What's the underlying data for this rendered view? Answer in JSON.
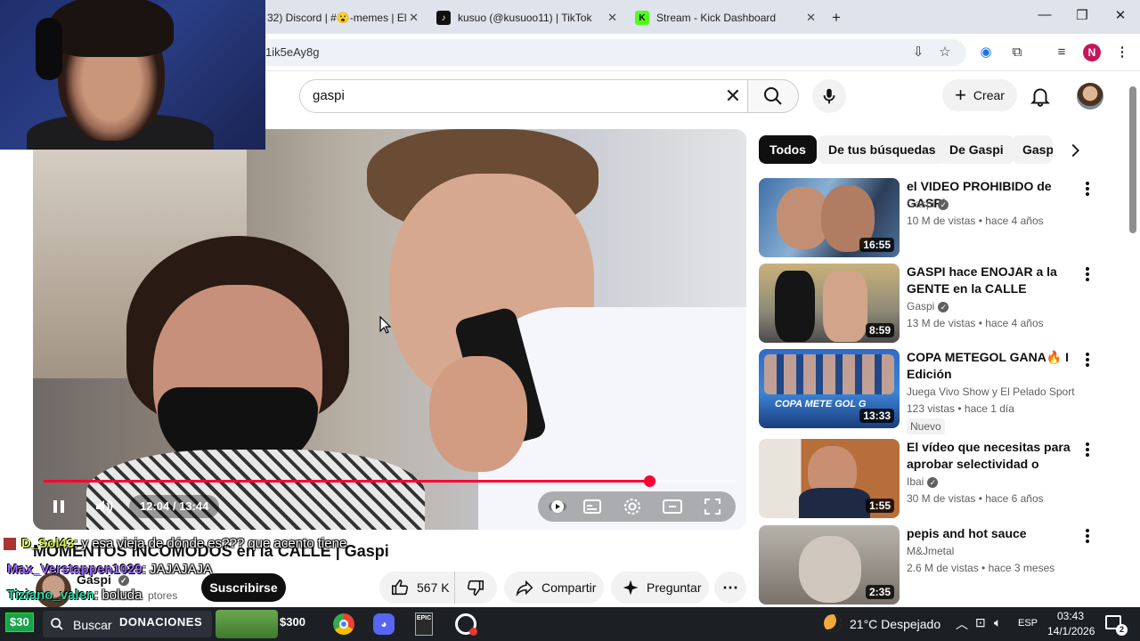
{
  "browser": {
    "tabs": [
      {
        "label": "32) Discord | #😮-memes | El"
      },
      {
        "label": "kusuo (@kusuoo11) | TikTok"
      },
      {
        "label": "Stream - Kick Dashboard"
      }
    ],
    "new_tab": "+",
    "url": "1ik5eAy8g",
    "profile_initial": "N"
  },
  "youtube": {
    "search_value": "gaspi",
    "create_label": "Crear"
  },
  "video": {
    "time": "12:04 / 13:44",
    "progress": 0.874,
    "title": "MOMENTOS INCOMODOS en la CALLE | Gaspi",
    "channel": "Gaspi",
    "subs_partial": "ptores",
    "subscribe_label": "Suscribirse",
    "likes": "567 K",
    "share_label": "Compartir",
    "ask_label": "Preguntar"
  },
  "chat": [
    {
      "user": "D_Sol43",
      "message": ": y esa vieja de dónde es??? que acento tiene"
    },
    {
      "user": "Max_Verstappen1029",
      "message": ": JAJAJAJA"
    },
    {
      "user": "Tiziano_valen",
      "message": ": boluda"
    }
  ],
  "chips": [
    {
      "label": "Todos",
      "active": true
    },
    {
      "label": "De tus búsquedas"
    },
    {
      "label": "De Gaspi"
    },
    {
      "label": "Gaspi"
    }
  ],
  "recommendations": [
    {
      "title": "el VIDEO PROHIBIDO de GASPI",
      "channel": "Gaspi",
      "verified": true,
      "meta": "10 M de vistas • hace 4 años",
      "duration": "16:55"
    },
    {
      "title": "GASPI hace ENOJAR a la GENTE en la CALLE",
      "channel": "Gaspi",
      "verified": true,
      "meta": "13 M de vistas • hace 4 años",
      "duration": "8:59"
    },
    {
      "title": "COPA METEGOL GANA🔥 I Edición",
      "channel": "Juega Vivo Show y El Pelado Sport",
      "verified": false,
      "meta": "123 vistas • hace 1 día",
      "badge": "Nuevo",
      "duration": "13:33",
      "thumb_text": "COPA METE GOL G"
    },
    {
      "title": "El vídeo que necesitas para aprobar selectividad o cualqui...",
      "channel": "Ibai",
      "verified": true,
      "meta": "30 M de vistas • hace 6 años",
      "duration": "1:55"
    },
    {
      "title": "pepis and hot sauce",
      "channel": "M&Jmetal",
      "verified": false,
      "meta": "2.6 M de vistas • hace 3 meses",
      "duration": "2:35"
    }
  ],
  "taskbar": {
    "donation_amount": "$30",
    "search_label": "Buscar",
    "donaciones_label": "DONACIONES",
    "goal_amount": "$300",
    "weather": "21°C  Despejado",
    "language": "ESP",
    "time": "03:43",
    "date": "14/1/2026",
    "notifications": "2"
  }
}
